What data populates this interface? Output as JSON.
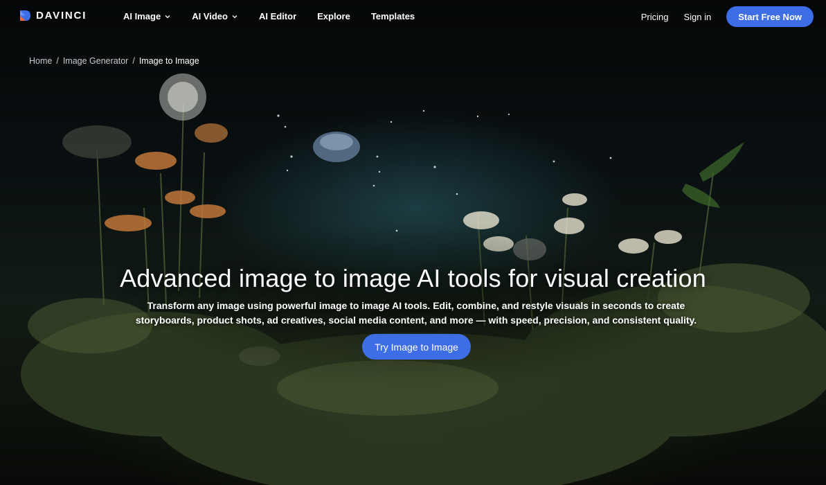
{
  "brand": {
    "name": "DAVINCI",
    "accent": "#3d6ee6"
  },
  "nav": {
    "items": [
      {
        "label": "AI Image",
        "dropdown": true
      },
      {
        "label": "AI Video",
        "dropdown": true
      },
      {
        "label": "AI Editor",
        "dropdown": false
      },
      {
        "label": "Explore",
        "dropdown": false
      },
      {
        "label": "Templates",
        "dropdown": false
      }
    ],
    "pricing": "Pricing",
    "signin": "Sign in",
    "cta": "Start Free Now"
  },
  "breadcrumb": {
    "items": [
      "Home",
      "Image Generator"
    ],
    "current": "Image to Image"
  },
  "hero": {
    "title": "Advanced image to image AI tools for visual creation",
    "subtitle": "Transform any image using powerful image to image AI tools. Edit, combine, and restyle visuals in seconds to create storyboards, product shots, ad creatives, social media content, and more — with speed, precision, and consistent quality.",
    "cta": "Try Image to Image",
    "background": "dark botanical garden with wildflowers and a floating jellyfish"
  }
}
